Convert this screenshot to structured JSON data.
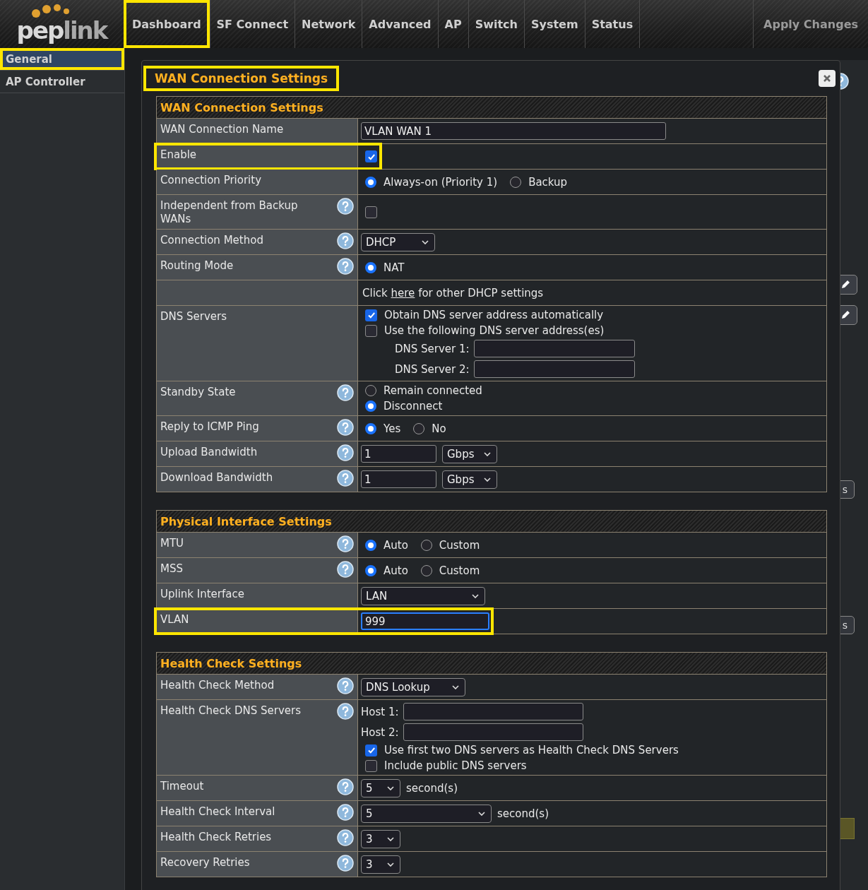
{
  "logo": {
    "text_1": "pep",
    "text_2": "link"
  },
  "nav": {
    "tabs": [
      {
        "label": "Dashboard",
        "highlighted": true
      },
      {
        "label": "SF Connect",
        "highlighted": false
      },
      {
        "label": "Network",
        "highlighted": false
      },
      {
        "label": "Advanced",
        "highlighted": false
      },
      {
        "label": "AP",
        "highlighted": false
      },
      {
        "label": "Switch",
        "highlighted": false
      },
      {
        "label": "System",
        "highlighted": false
      },
      {
        "label": "Status",
        "highlighted": false
      }
    ],
    "apply": "Apply Changes"
  },
  "sidebar": [
    {
      "label": "General",
      "selected": true,
      "highlighted": true
    },
    {
      "label": "AP Controller",
      "selected": false,
      "highlighted": false
    }
  ],
  "dialog": {
    "title": "WAN Connection Settings",
    "highlighted": true,
    "sections": [
      {
        "title": "WAN Connection Settings",
        "rows": [
          {
            "label": "WAN Connection Name",
            "help": false,
            "highlighted": false,
            "kind": "input",
            "value": "VLAN WAN 1",
            "focused": false
          },
          {
            "label": "Enable",
            "help": false,
            "highlighted": true,
            "kind": "checkbox",
            "checked": true
          },
          {
            "label": "Connection Priority",
            "help": false,
            "highlighted": false,
            "kind": "radios",
            "options": [
              {
                "label": "Always-on (Priority 1)",
                "selected": true
              },
              {
                "label": "Backup",
                "selected": false
              }
            ]
          },
          {
            "label": "Independent from Backup WANs",
            "help": true,
            "highlighted": false,
            "kind": "checkbox",
            "checked": false
          },
          {
            "label": "Connection Method",
            "help": true,
            "highlighted": false,
            "kind": "select",
            "value": "DHCP"
          },
          {
            "label": "Routing Mode",
            "help": true,
            "highlighted": false,
            "kind": "radios",
            "options": [
              {
                "label": "NAT",
                "selected": true
              }
            ]
          },
          {
            "help": false,
            "highlighted": false,
            "kind": "note",
            "before": "Click",
            "link": "here",
            "after": "for other DHCP settings"
          },
          {
            "label": "DNS Servers",
            "help": false,
            "highlighted": false,
            "kind": "dns",
            "checks": [
              {
                "label": "Obtain DNS server address automatically",
                "checked": true
              },
              {
                "label": "Use the following DNS server address(es)",
                "checked": false
              }
            ],
            "fields": [
              {
                "label": "DNS Server 1:"
              },
              {
                "label": "DNS Server 2:"
              }
            ]
          },
          {
            "label": "Standby State",
            "help": true,
            "highlighted": false,
            "kind": "radio-stack",
            "options": [
              {
                "label": "Remain connected",
                "selected": false
              },
              {
                "label": "Disconnect",
                "selected": true
              }
            ]
          },
          {
            "label": "Reply to ICMP Ping",
            "help": true,
            "highlighted": false,
            "kind": "radios",
            "options": [
              {
                "label": "Yes",
                "selected": true
              },
              {
                "label": "No",
                "selected": false
              }
            ]
          },
          {
            "label": "Upload Bandwidth",
            "help": true,
            "highlighted": false,
            "kind": "input-select",
            "value": "1",
            "unit": "Gbps"
          },
          {
            "label": "Download Bandwidth",
            "help": true,
            "highlighted": false,
            "kind": "input-select",
            "value": "1",
            "unit": "Gbps"
          }
        ]
      },
      {
        "title": "Physical Interface Settings",
        "rows": [
          {
            "label": "MTU",
            "help": true,
            "highlighted": false,
            "kind": "radios",
            "options": [
              {
                "label": "Auto",
                "selected": true
              },
              {
                "label": "Custom",
                "selected": false
              }
            ]
          },
          {
            "label": "MSS",
            "help": true,
            "highlighted": false,
            "kind": "radios",
            "options": [
              {
                "label": "Auto",
                "selected": true
              },
              {
                "label": "Custom",
                "selected": false
              }
            ]
          },
          {
            "label": "Uplink Interface",
            "help": false,
            "highlighted": false,
            "kind": "select",
            "value": "LAN"
          },
          {
            "label": "VLAN",
            "help": false,
            "highlighted": true,
            "kind": "input",
            "value": "999",
            "focused": true
          }
        ]
      },
      {
        "title": "Health Check Settings",
        "rows": [
          {
            "label": "Health Check Method",
            "help": true,
            "highlighted": false,
            "kind": "select",
            "value": "DNS Lookup"
          },
          {
            "label": "Health Check DNS Servers",
            "help": true,
            "highlighted": false,
            "kind": "hosts",
            "fields": [
              {
                "label": "Host 1:"
              },
              {
                "label": "Host 2:"
              }
            ],
            "checks": [
              {
                "label": "Use first two DNS servers as Health Check DNS Servers",
                "checked": true
              },
              {
                "label": "Include public DNS servers",
                "checked": false
              }
            ]
          },
          {
            "label": "Timeout",
            "help": true,
            "highlighted": false,
            "kind": "select",
            "value": "5",
            "suffix": "second(s)"
          },
          {
            "label": "Health Check Interval",
            "help": true,
            "highlighted": false,
            "kind": "select",
            "value": "5",
            "suffix": "second(s)"
          },
          {
            "label": "Health Check Retries",
            "help": true,
            "highlighted": false,
            "kind": "select",
            "value": "3"
          },
          {
            "label": "Recovery Retries",
            "help": true,
            "highlighted": false,
            "kind": "select",
            "value": "3"
          }
        ]
      }
    ]
  },
  "background": [
    {
      "kind": "help"
    },
    {
      "kind": "edit"
    },
    {
      "kind": "edit"
    },
    {
      "kind": "cut-button",
      "label": "s"
    },
    {
      "kind": "cut-button",
      "label": "s"
    },
    {
      "kind": "block"
    }
  ]
}
